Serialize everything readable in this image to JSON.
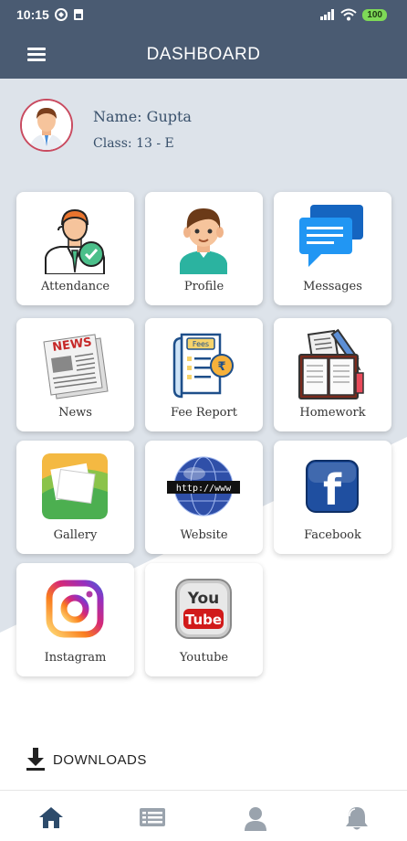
{
  "status_bar": {
    "time": "10:15",
    "battery": "100"
  },
  "app_bar": {
    "title": "DASHBOARD"
  },
  "profile": {
    "name": "Name: Gupta",
    "class": "Class: 13 - E"
  },
  "tiles": [
    {
      "label": "Attendance",
      "icon": "attendance-icon"
    },
    {
      "label": "Profile",
      "icon": "profile-icon"
    },
    {
      "label": "Messages",
      "icon": "messages-icon"
    },
    {
      "label": "News",
      "icon": "news-icon"
    },
    {
      "label": "Fee Report",
      "icon": "fee-report-icon"
    },
    {
      "label": "Homework",
      "icon": "homework-icon"
    },
    {
      "label": "Gallery",
      "icon": "gallery-icon"
    },
    {
      "label": "Website",
      "icon": "website-icon"
    },
    {
      "label": "Facebook",
      "icon": "facebook-icon"
    },
    {
      "label": "Instagram",
      "icon": "instagram-icon"
    },
    {
      "label": "Youtube",
      "icon": "youtube-icon"
    }
  ],
  "fee_icon": {
    "tag": "Fees",
    "currency": "₹"
  },
  "news_icon": {
    "text": "NEWS"
  },
  "website_icon": {
    "text": "http://www"
  },
  "facebook_icon": {
    "letter": "f"
  },
  "youtube_icon": {
    "top": "You",
    "bottom": "Tube"
  },
  "downloads": {
    "label": "DOWNLOADS"
  },
  "bottom_nav": [
    {
      "name": "home",
      "icon": "home-icon",
      "active": true
    },
    {
      "name": "list",
      "icon": "list-icon",
      "active": false
    },
    {
      "name": "user",
      "icon": "user-icon",
      "active": false
    },
    {
      "name": "notifications",
      "icon": "bell-icon",
      "active": false
    }
  ],
  "colors": {
    "header": "#4a5b72",
    "background_shape": "#dde3ea",
    "active_nav": "#2d4b6b",
    "inactive_nav": "#9aa3ad",
    "avatar_ring": "#c94b60"
  }
}
